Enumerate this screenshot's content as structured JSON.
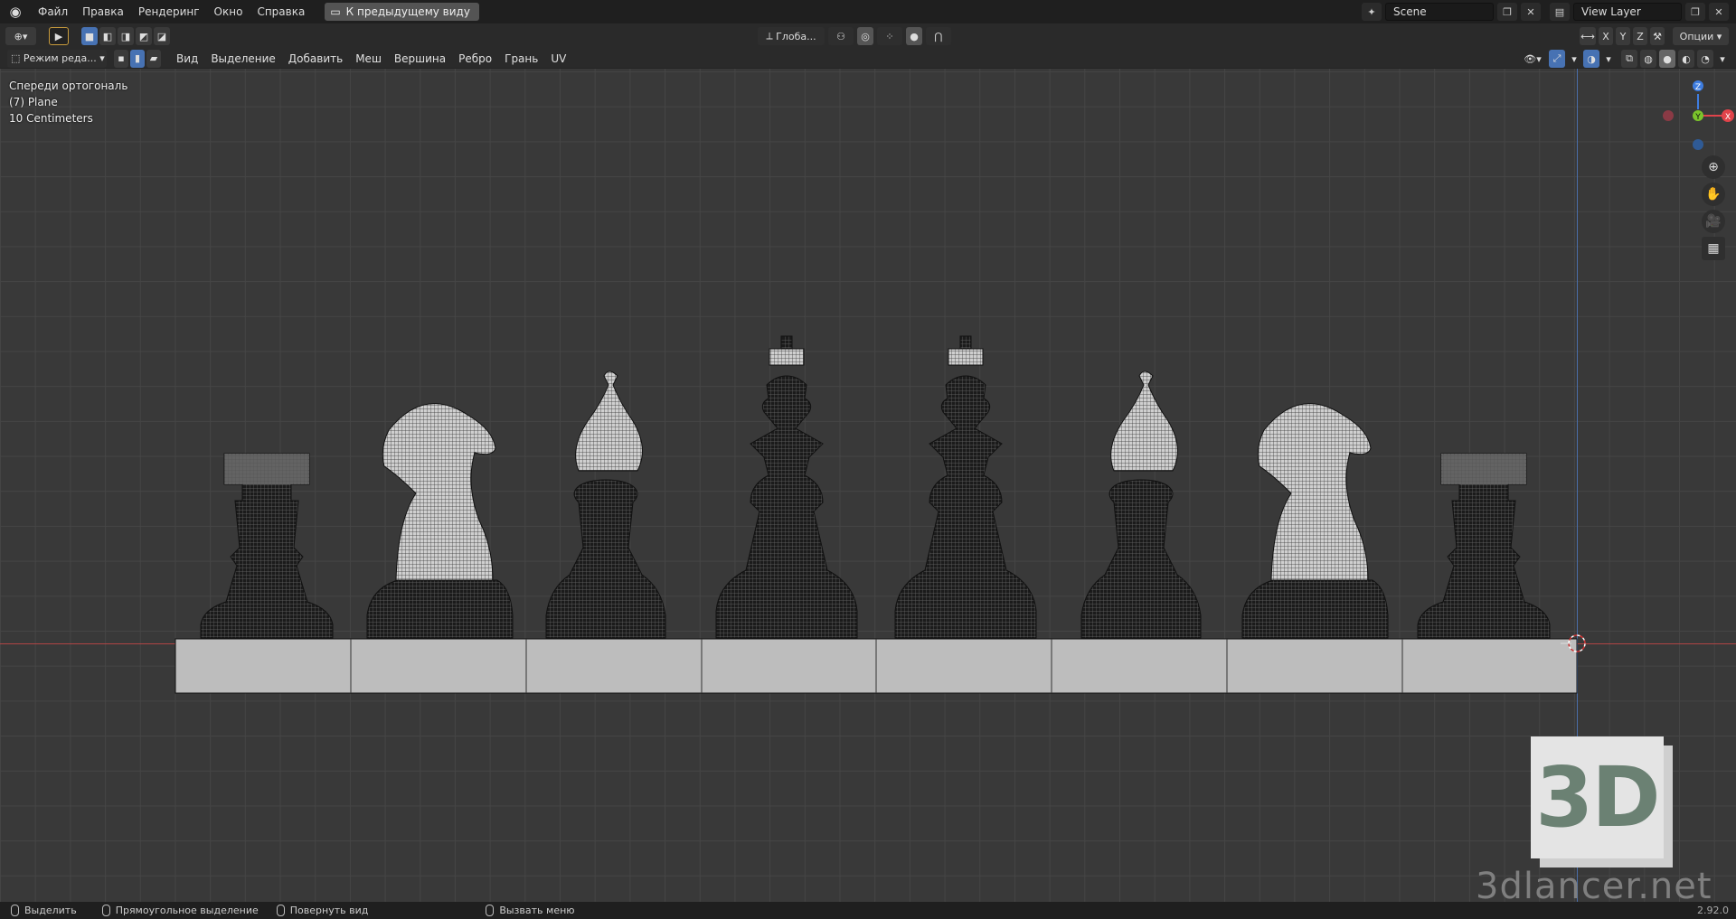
{
  "topbar": {
    "menus": [
      "Файл",
      "Правка",
      "Рендеринг",
      "Окно",
      "Справка"
    ],
    "back_label": "К предыдущему виду",
    "scene": "Scene",
    "view_layer": "View Layer"
  },
  "header": {
    "orientation": "Глоба...",
    "options_label": "Опции",
    "axes": [
      "X",
      "Y",
      "Z"
    ]
  },
  "editbar": {
    "mode": "Режим реда...",
    "menus": [
      "Вид",
      "Выделение",
      "Добавить",
      "Меш",
      "Вершина",
      "Ребро",
      "Грань",
      "UV"
    ]
  },
  "viewport": {
    "view_name": "Спереди ортогональ",
    "object": "(7) Plane",
    "scale": "10 Centimeters",
    "pieces": [
      "rook",
      "knight",
      "bishop",
      "king",
      "king",
      "bishop",
      "knight",
      "rook"
    ]
  },
  "gizmo": {
    "z": "Z",
    "y": "Y",
    "x": "X"
  },
  "watermark": {
    "logo": "3D",
    "site": "3dlancer.net"
  },
  "statusbar": {
    "select": "Выделить",
    "box_select": "Прямоугольное выделение",
    "rotate": "Повернуть вид",
    "menu": "Вызвать меню",
    "version": "2.92.0"
  },
  "colors": {
    "accent": "#4772b3",
    "x_axis": "#b04545",
    "z_axis": "#4a6ea8"
  }
}
